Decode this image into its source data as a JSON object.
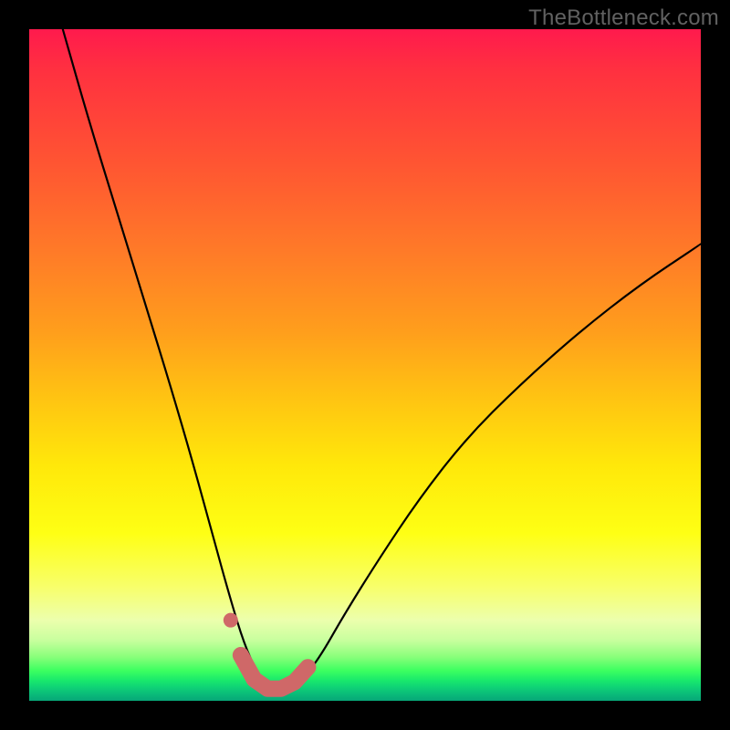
{
  "watermark": "TheBottleneck.com",
  "chart_data": {
    "type": "line",
    "title": "",
    "xlabel": "",
    "ylabel": "",
    "xlim": [
      0,
      1
    ],
    "ylim": [
      0,
      1
    ],
    "series": [
      {
        "name": "bottleneck-curve",
        "x": [
          0.05,
          0.09,
          0.13,
          0.17,
          0.21,
          0.245,
          0.275,
          0.3,
          0.32,
          0.34,
          0.36,
          0.38,
          0.4,
          0.43,
          0.47,
          0.52,
          0.58,
          0.65,
          0.73,
          0.82,
          0.91,
          1.0
        ],
        "y": [
          1.0,
          0.86,
          0.73,
          0.6,
          0.47,
          0.35,
          0.24,
          0.15,
          0.085,
          0.04,
          0.015,
          0.015,
          0.025,
          0.06,
          0.13,
          0.21,
          0.3,
          0.39,
          0.47,
          0.55,
          0.62,
          0.68
        ]
      }
    ],
    "highlight": {
      "name": "minimum-band",
      "x": [
        0.315,
        0.335,
        0.355,
        0.375,
        0.395,
        0.415
      ],
      "y": [
        0.068,
        0.032,
        0.018,
        0.018,
        0.028,
        0.05
      ]
    },
    "highlight_isolated_point": {
      "x": 0.3,
      "y": 0.12
    },
    "gradient_stops": [
      {
        "pos": 0.0,
        "color": "#ff1a4d"
      },
      {
        "pos": 0.33,
        "color": "#ff7a28"
      },
      {
        "pos": 0.65,
        "color": "#ffe80a"
      },
      {
        "pos": 0.88,
        "color": "#ecffad"
      },
      {
        "pos": 0.955,
        "color": "#3cff60"
      },
      {
        "pos": 1.0,
        "color": "#07a778"
      }
    ],
    "highlight_color": "#cf6868"
  }
}
